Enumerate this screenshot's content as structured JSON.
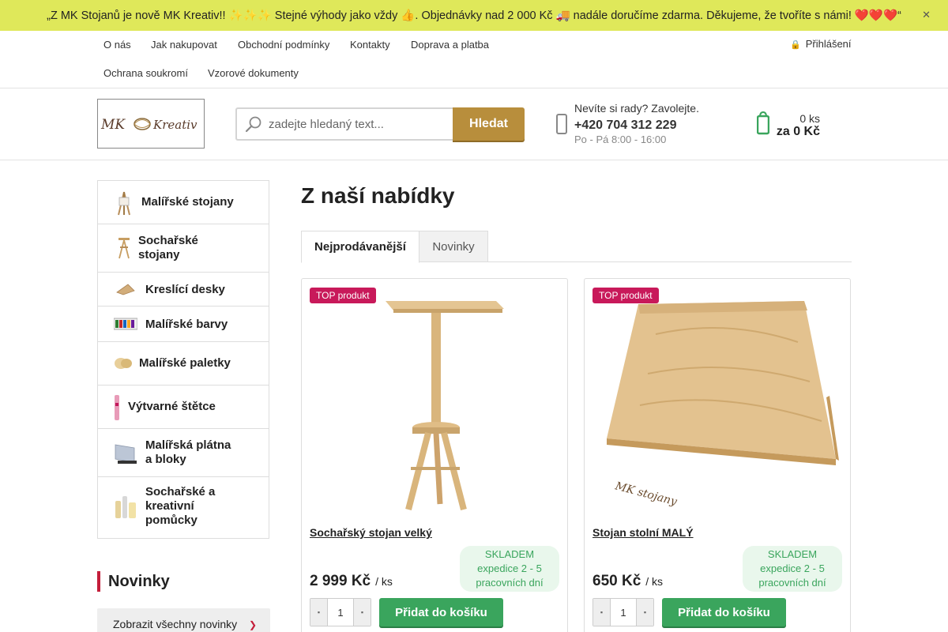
{
  "announcement": {
    "text": "„Z MK Stojanů je nově MK Kreativ!! ✨✨✨ Stejné výhody jako vždy 👍. Objednávky nad 2 000 Kč 🚚 nadále doručíme zdarma. Děkujeme, že tvoříte s námi! ❤️❤️❤️“",
    "close": "✕"
  },
  "topnav": {
    "row1": [
      "O nás",
      "Jak nakupovat",
      "Obchodní podmínky",
      "Kontakty",
      "Doprava a platba"
    ],
    "row2": [
      "Ochrana soukromí",
      "Vzorové dokumenty"
    ],
    "login": "Přihlášení"
  },
  "logo": {
    "text": "MK Kreativ"
  },
  "search": {
    "placeholder": "zadejte hledaný text...",
    "button": "Hledat"
  },
  "help": {
    "line1": "Nevíte si rady? Zavolejte.",
    "phone": "+420 704 312 229",
    "hours": "Po - Pá 8:00 - 16:00"
  },
  "cart": {
    "count": "0 ks",
    "total": "za 0 Kč"
  },
  "categories": [
    "Malířské stojany",
    "Sochařské stojany",
    "Kreslící desky",
    "Malířské barvy",
    "Malířské paletky",
    "Výtvarné štětce",
    "Malířská plátna a bloky",
    "Sochařské a kreativní pomůcky"
  ],
  "news": {
    "heading": "Novinky",
    "all_link": "Zobrazit všechny novinky"
  },
  "main": {
    "title": "Z naší nabídky",
    "tabs": [
      "Nejprodávanější",
      "Novinky"
    ]
  },
  "products": [
    {
      "badge": "TOP produkt",
      "name": "Sochařský stojan velký",
      "stock": [
        "SKLADEM",
        "expedice 2 - 5",
        "pracovních dní"
      ],
      "price": "2 999 Kč",
      "unit": "/ ks",
      "qty": "1",
      "add": "Přidat do košíku"
    },
    {
      "badge": "TOP produkt",
      "name": "Stojan stolní MALÝ",
      "stock": [
        "SKLADEM",
        "expedice 2 - 5",
        "pracovních dní"
      ],
      "price": "650 Kč",
      "unit": "/ ks",
      "qty": "1",
      "add": "Přidat do košíku",
      "watermark": "MK stojany"
    }
  ],
  "colors": {
    "announce_bg": "#dfe85a",
    "search_btn": "#b88e3c",
    "add_btn": "#3aa55d",
    "badge": "#c8195a",
    "accent": "#c41e3a"
  }
}
